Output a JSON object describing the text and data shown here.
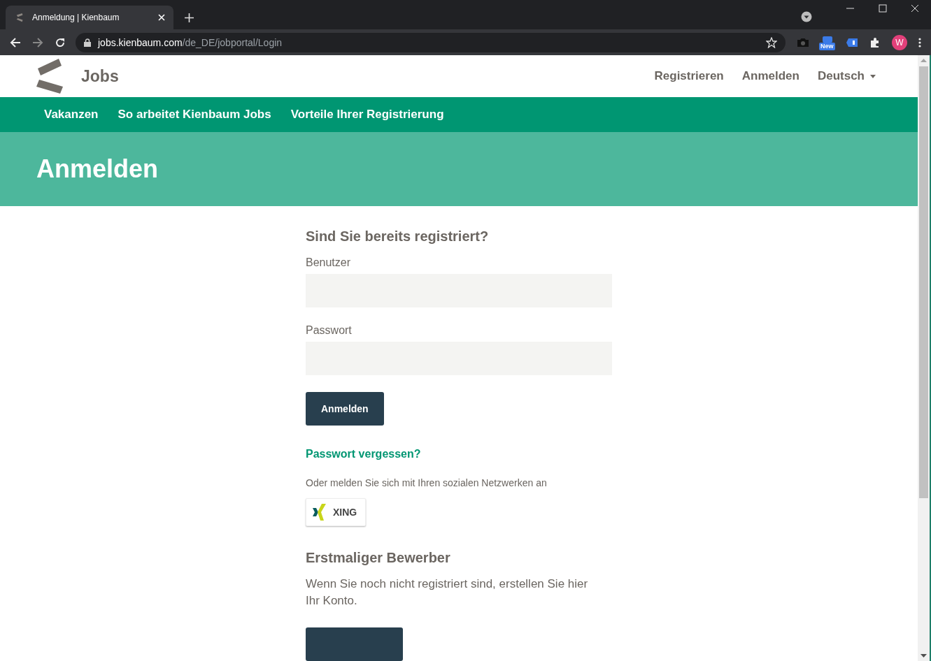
{
  "browser": {
    "tab_title": "Anmeldung | Kienbaum",
    "url_host": "jobs.kienbaum.com",
    "url_path": "/de_DE/jobportal/Login",
    "extension_badge": "New",
    "avatar": "W"
  },
  "header": {
    "brand": "Jobs",
    "links": [
      {
        "label": "Registrieren",
        "kind": "link"
      },
      {
        "label": "Anmelden",
        "kind": "link"
      },
      {
        "label": "Deutsch",
        "kind": "dropdown"
      }
    ]
  },
  "main_nav": [
    "Vakanzen",
    "So arbeitet Kienbaum Jobs",
    "Vorteile Ihrer Registrierung"
  ],
  "hero": {
    "title": "Anmelden"
  },
  "login": {
    "heading": "Sind Sie bereits registriert?",
    "fields": [
      {
        "label": "Benutzer"
      },
      {
        "label": "Passwort"
      }
    ],
    "submit": "Anmelden",
    "forgot_link": "Passwort vergessen?",
    "social_text": "Oder melden Sie sich mit Ihren sozialen Netzwerken an",
    "social_button": "XING"
  },
  "first_time": {
    "heading": "Erstmaliger Bewerber",
    "text": "Wenn Sie noch nicht registriert sind, erstellen Sie hier Ihr Konto."
  }
}
